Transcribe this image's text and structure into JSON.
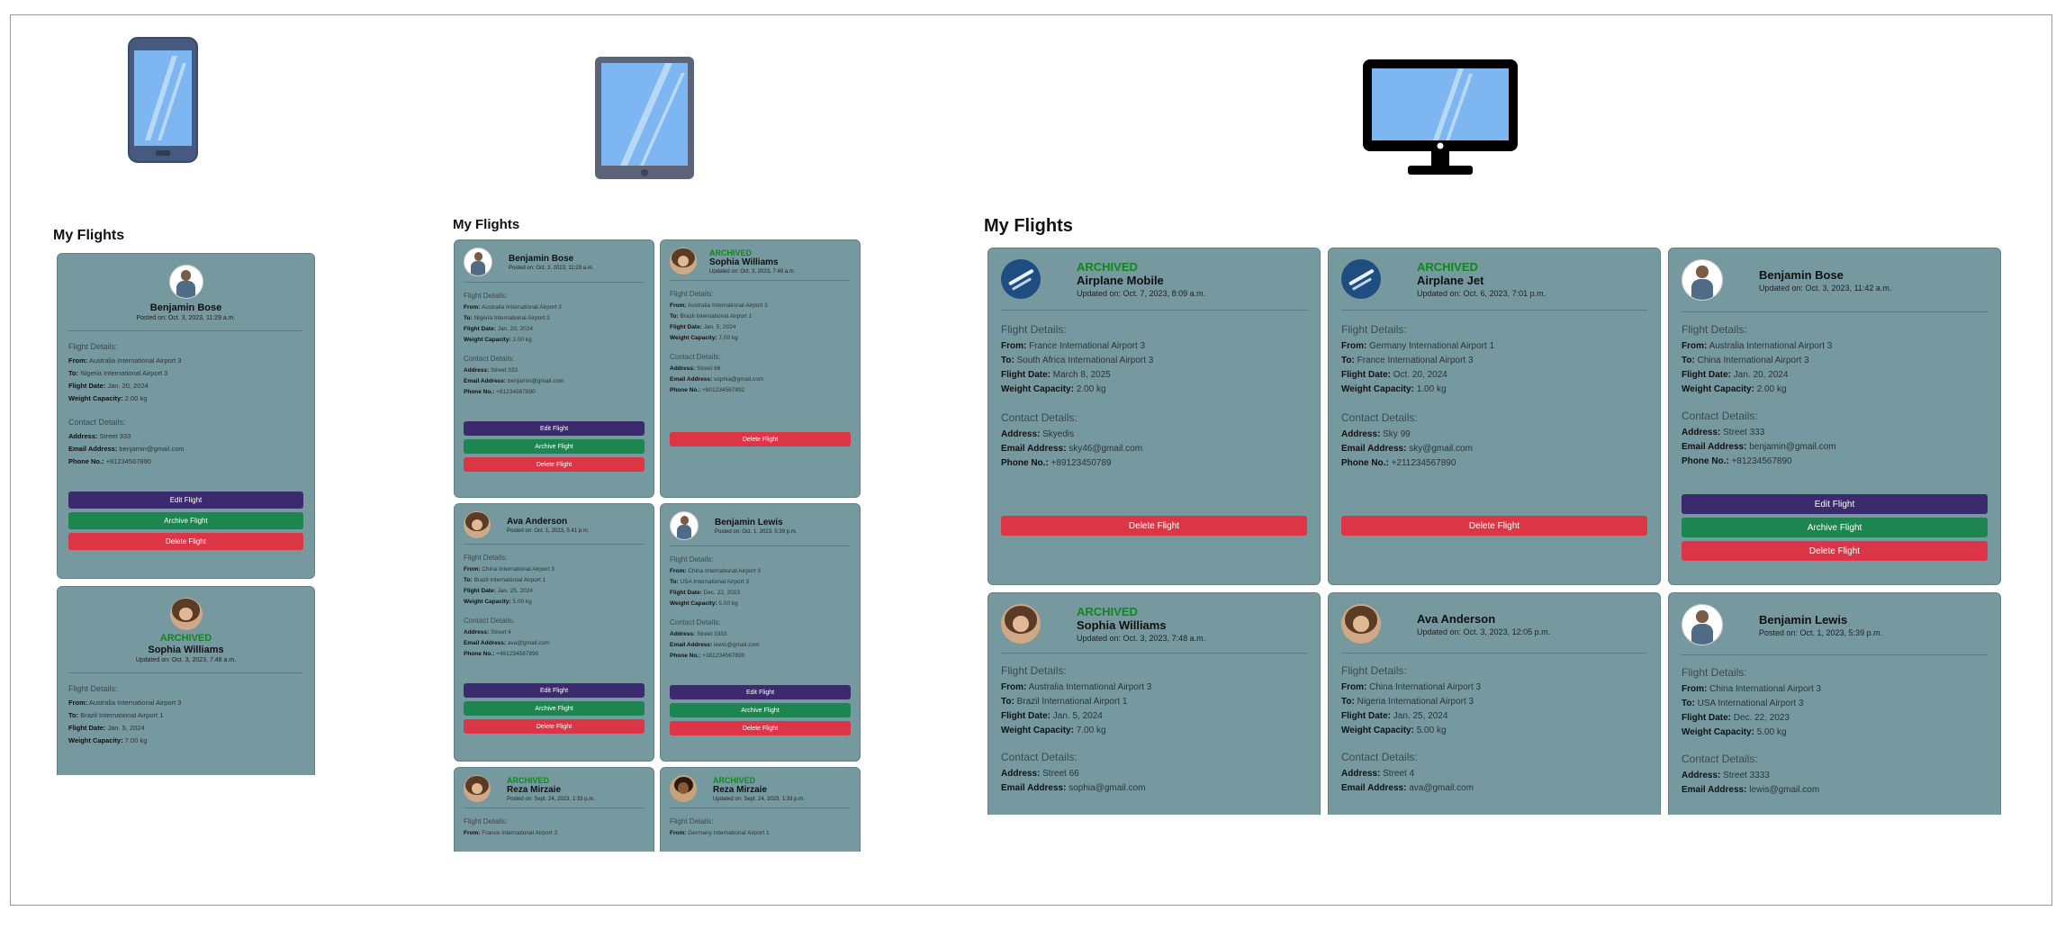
{
  "panel_title": "My Flights",
  "labels": {
    "flight_details": "Flight Details:",
    "contact_details": "Contact Details:",
    "from": "From:",
    "to": "To:",
    "date": "Flight Date:",
    "weight": "Weight Capacity:",
    "address": "Address:",
    "email": "Email Address:",
    "phone": "Phone No.:",
    "archived": "ARCHIVED",
    "edit": "Edit Flight",
    "archive": "Archive Flight",
    "delete": "Delete Flight"
  },
  "devices": [
    "phone-icon",
    "tablet-icon",
    "desktop-icon"
  ],
  "mobile": [
    {
      "name": "Benjamin Bose",
      "posted": "Posted on: Oct. 3, 2023, 11:29 a.m.",
      "from": "Australia International Airport 3",
      "to": "Nigeria International Airport 3",
      "date": "Jan. 20, 2024",
      "weight": "2.00 kg",
      "address": "Street 333",
      "email": "benjamin@gmail.com",
      "phone": "+81234567890"
    },
    {
      "name": "Sophia Williams",
      "posted": "Updated on: Oct. 3, 2023, 7:48 a.m.",
      "from": "Australia International Airport 3",
      "to": "Brazil International Airport 1",
      "date": "Jan. 5, 2024",
      "weight": "7.00 kg"
    }
  ],
  "tablet": [
    {
      "name": "Benjamin Bose",
      "posted": "Posted on: Oct. 3, 2023, 11:29 a.m.",
      "from": "Australia International Airport 3",
      "to": "Nigeria International Airport 3",
      "date": "Jan. 20, 2024",
      "weight": "2.00 kg",
      "address": "Street 333",
      "email": "benjamin@gmail.com",
      "phone": "+81234567890"
    },
    {
      "name": "Sophia Williams",
      "posted": "Updated on: Oct. 3, 2023, 7:48 a.m.",
      "from": "Australia International Airport 3",
      "to": "Brazil International Airport 1",
      "date": "Jan. 5, 2024",
      "weight": "7.00 kg",
      "address": "Street 66",
      "email": "sophia@gmail.com",
      "phone": "+801234567892"
    },
    {
      "name": "Ava Anderson",
      "posted": "Posted on: Oct. 1, 2023, 5:41 p.m.",
      "from": "China International Airport 3",
      "to": "Brazil International Airport 1",
      "date": "Jan. 25, 2024",
      "weight": "5.00 kg",
      "address": "Street 4",
      "email": "ava@gmail.com",
      "phone": "+491234567890"
    },
    {
      "name": "Benjamin Lewis",
      "posted": "Posted on: Oct. 1, 2023, 5:39 p.m.",
      "from": "China International Airport 3",
      "to": "USA International Airport 3",
      "date": "Dec. 22, 2023",
      "weight": "5.00 kg",
      "address": "Street 3333",
      "email": "lewis@gmail.com",
      "phone": "+381234567890"
    },
    {
      "name": "Reza Mirzaie",
      "posted": "Posted on: Sept. 24, 2023, 1:33 p.m.",
      "from": "France International Airport 3"
    },
    {
      "name": "Reza Mirzaie",
      "posted": "Updated on: Sept. 24, 2023, 1:33 p.m.",
      "from": "Germany International Airport 1"
    }
  ],
  "desktop": [
    {
      "name": "Airplane Mobile",
      "posted": "Updated on: Oct. 7, 2023, 8:09 a.m.",
      "from": "France International Airport 3",
      "to": "South Africa International Airport 3",
      "date": "March 8, 2025",
      "weight": "2.00 kg",
      "address": "Skyedis",
      "email": "sky46@gmail.com",
      "phone": "+89123450789"
    },
    {
      "name": "Airplane Jet",
      "posted": "Updated on: Oct. 6, 2023, 7:01 p.m.",
      "from": "Germany International Airport 1",
      "to": "France International Airport 3",
      "date": "Oct. 20, 2024",
      "weight": "1.00 kg",
      "address": "Sky 99",
      "email": "sky@gmail.com",
      "phone": "+211234567890"
    },
    {
      "name": "Benjamin Bose",
      "posted": "Updated on: Oct. 3, 2023, 11:42 a.m.",
      "from": "Australia International Airport 3",
      "to": "China International Airport 3",
      "date": "Jan. 20, 2024",
      "weight": "2.00 kg",
      "address": "Street 333",
      "email": "benjamin@gmail.com",
      "phone": "+81234567890"
    },
    {
      "name": "Sophia Williams",
      "posted": "Updated on: Oct. 3, 2023, 7:48 a.m.",
      "from": "Australia International Airport 3",
      "to": "Brazil International Airport 1",
      "date": "Jan. 5, 2024",
      "weight": "7.00 kg",
      "address": "Street 66",
      "email": "sophia@gmail.com"
    },
    {
      "name": "Ava Anderson",
      "posted": "Updated on: Oct. 3, 2023, 12:05 p.m.",
      "from": "China International Airport 3",
      "to": "Nigeria International Airport 3",
      "date": "Jan. 25, 2024",
      "weight": "5.00 kg",
      "address": "Street 4",
      "email": "ava@gmail.com"
    },
    {
      "name": "Benjamin Lewis",
      "posted": "Posted on: Oct. 1, 2023, 5:39 p.m.",
      "from": "China International Airport 3",
      "to": "USA International Airport 3",
      "date": "Dec. 22, 2023",
      "weight": "5.00 kg",
      "address": "Street 3333",
      "email": "lewis@gmail.com"
    }
  ]
}
